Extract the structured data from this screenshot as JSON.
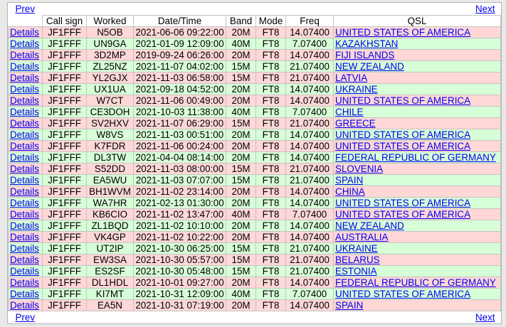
{
  "nav": {
    "prev_label": "Prev",
    "next_label": "Next"
  },
  "headers": {
    "blank": "",
    "callsign": "Call sign",
    "worked": "Worked",
    "datetime": "Date/Time",
    "band": "Band",
    "mode": "Mode",
    "freq": "Freq",
    "qsl": "QSL"
  },
  "details_label": "Details",
  "colors": {
    "pink_row": "#ffd7d7",
    "green_row": "#d7ffd7",
    "link": "#0000ee"
  },
  "rows": [
    {
      "callsign": "JF1FFF",
      "worked": "N5OB",
      "datetime": "2021-06-06 09:22:00",
      "band": "20M",
      "mode": "FT8",
      "freq": "14.07400",
      "qsl": "UNITED STATES OF AMERICA",
      "tone": "pink"
    },
    {
      "callsign": "JF1FFF",
      "worked": "UN9GA",
      "datetime": "2021-01-09 12:09:00",
      "band": "40M",
      "mode": "FT8",
      "freq": "7.07400",
      "qsl": "KAZAKHSTAN",
      "tone": "green"
    },
    {
      "callsign": "JF1FFF",
      "worked": "3D2MP",
      "datetime": "2019-09-24 06:26:00",
      "band": "20M",
      "mode": "FT8",
      "freq": "14.07400",
      "qsl": "FIJI ISLANDS",
      "tone": "pink"
    },
    {
      "callsign": "JF1FFF",
      "worked": "ZL25NZ",
      "datetime": "2021-11-07 04:02:00",
      "band": "15M",
      "mode": "FT8",
      "freq": "21.07400",
      "qsl": "NEW ZEALAND",
      "tone": "green"
    },
    {
      "callsign": "JF1FFF",
      "worked": "YL2GJX",
      "datetime": "2021-11-03 06:58:00",
      "band": "15M",
      "mode": "FT8",
      "freq": "21.07400",
      "qsl": "LATVIA",
      "tone": "pink"
    },
    {
      "callsign": "JF1FFF",
      "worked": "UX1UA",
      "datetime": "2021-09-18 04:52:00",
      "band": "20M",
      "mode": "FT8",
      "freq": "14.07400",
      "qsl": "UKRAINE",
      "tone": "green"
    },
    {
      "callsign": "JF1FFF",
      "worked": "W7CT",
      "datetime": "2021-11-06 00:49:00",
      "band": "20M",
      "mode": "FT8",
      "freq": "14.07400",
      "qsl": "UNITED STATES OF AMERICA",
      "tone": "pink"
    },
    {
      "callsign": "JF1FFF",
      "worked": "CE3DOH",
      "datetime": "2021-10-03 11:38:00",
      "band": "40M",
      "mode": "FT8",
      "freq": "7.07400",
      "qsl": "CHILE",
      "tone": "green"
    },
    {
      "callsign": "JF1FFF",
      "worked": "SV2HXV",
      "datetime": "2021-11-07 06:29:00",
      "band": "15M",
      "mode": "FT8",
      "freq": "21.07400",
      "qsl": "GREECE",
      "tone": "pink"
    },
    {
      "callsign": "JF1FFF",
      "worked": "W8VS",
      "datetime": "2021-11-03 00:51:00",
      "band": "20M",
      "mode": "FT8",
      "freq": "14.07400",
      "qsl": "UNITED STATES OF AMERICA",
      "tone": "green"
    },
    {
      "callsign": "JF1FFF",
      "worked": "K7FDR",
      "datetime": "2021-11-06 00:24:00",
      "band": "20M",
      "mode": "FT8",
      "freq": "14.07400",
      "qsl": "UNITED STATES OF AMERICA",
      "tone": "pink"
    },
    {
      "callsign": "JF1FFF",
      "worked": "DL3TW",
      "datetime": "2021-04-04 08:14:00",
      "band": "20M",
      "mode": "FT8",
      "freq": "14.07400",
      "qsl": "FEDERAL REPUBLIC OF GERMANY",
      "tone": "green"
    },
    {
      "callsign": "JF1FFF",
      "worked": "S52DD",
      "datetime": "2021-11-03 08:00:00",
      "band": "15M",
      "mode": "FT8",
      "freq": "21.07400",
      "qsl": "SLOVENIA",
      "tone": "pink"
    },
    {
      "callsign": "JF1FFF",
      "worked": "EA5WU",
      "datetime": "2021-11-03 07:07:00",
      "band": "15M",
      "mode": "FT8",
      "freq": "21.07400",
      "qsl": "SPAIN",
      "tone": "green"
    },
    {
      "callsign": "JF1FFF",
      "worked": "BH1WVM",
      "datetime": "2021-11-02 23:14:00",
      "band": "20M",
      "mode": "FT8",
      "freq": "14.07400",
      "qsl": "CHINA",
      "tone": "pink"
    },
    {
      "callsign": "JF1FFF",
      "worked": "WA7HR",
      "datetime": "2021-02-13 01:30:00",
      "band": "20M",
      "mode": "FT8",
      "freq": "14.07400",
      "qsl": "UNITED STATES OF AMERICA",
      "tone": "green"
    },
    {
      "callsign": "JF1FFF",
      "worked": "KB6CIO",
      "datetime": "2021-11-02 13:47:00",
      "band": "40M",
      "mode": "FT8",
      "freq": "7.07400",
      "qsl": "UNITED STATES OF AMERICA",
      "tone": "pink"
    },
    {
      "callsign": "JF1FFF",
      "worked": "ZL1BQD",
      "datetime": "2021-11-02 10:10:00",
      "band": "20M",
      "mode": "FT8",
      "freq": "14.07400",
      "qsl": "NEW ZEALAND",
      "tone": "green"
    },
    {
      "callsign": "JF1FFF",
      "worked": "VK4GP",
      "datetime": "2021-11-02 10:22:00",
      "band": "20M",
      "mode": "FT8",
      "freq": "14.07400",
      "qsl": "AUSTRALIA",
      "tone": "pink"
    },
    {
      "callsign": "JF1FFF",
      "worked": "UT2IP",
      "datetime": "2021-10-30 06:25:00",
      "band": "15M",
      "mode": "FT8",
      "freq": "21.07400",
      "qsl": "UKRAINE",
      "tone": "green"
    },
    {
      "callsign": "JF1FFF",
      "worked": "EW3SA",
      "datetime": "2021-10-30 05:57:00",
      "band": "15M",
      "mode": "FT8",
      "freq": "21.07400",
      "qsl": "BELARUS",
      "tone": "pink"
    },
    {
      "callsign": "JF1FFF",
      "worked": "ES2SF",
      "datetime": "2021-10-30 05:48:00",
      "band": "15M",
      "mode": "FT8",
      "freq": "21.07400",
      "qsl": "ESTONIA",
      "tone": "green"
    },
    {
      "callsign": "JF1FFF",
      "worked": "DL1HDL",
      "datetime": "2021-10-01 09:27:00",
      "band": "20M",
      "mode": "FT8",
      "freq": "14.07400",
      "qsl": "FEDERAL REPUBLIC OF GERMANY",
      "tone": "pink"
    },
    {
      "callsign": "JF1FFF",
      "worked": "KI7MT",
      "datetime": "2021-10-31 12:09:00",
      "band": "40M",
      "mode": "FT8",
      "freq": "7.07400",
      "qsl": "UNITED STATES OF AMERICA",
      "tone": "green"
    },
    {
      "callsign": "JF1FFF",
      "worked": "EA5N",
      "datetime": "2021-10-31 07:19:00",
      "band": "20M",
      "mode": "FT8",
      "freq": "14.07400",
      "qsl": "SPAIN",
      "tone": "pink"
    }
  ]
}
